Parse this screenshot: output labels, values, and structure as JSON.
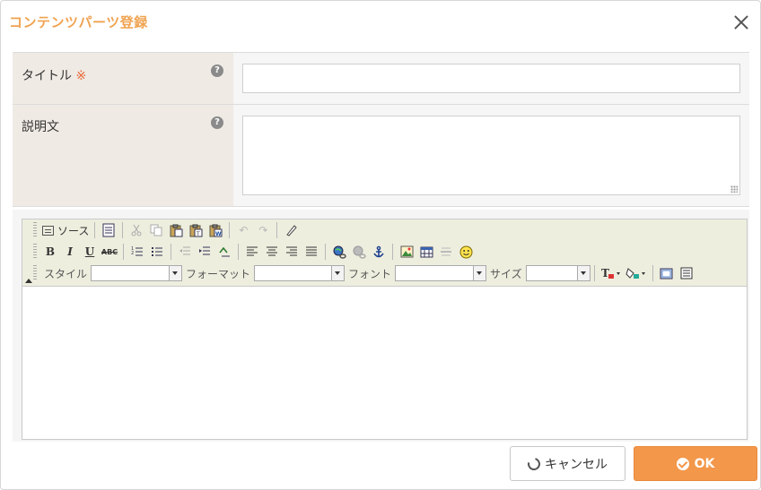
{
  "dialog": {
    "title": "コンテンツパーツ登録"
  },
  "form": {
    "title_field": {
      "label": "タイトル",
      "required_mark": "※",
      "value": ""
    },
    "description_field": {
      "label": "説明文",
      "value": ""
    },
    "help_glyph": "?"
  },
  "editor": {
    "toolbar": {
      "source_label": "ソース",
      "bold_glyph": "B",
      "italic_glyph": "I",
      "underline_glyph": "U",
      "strike_glyph": "ABC",
      "style_label": "スタイル",
      "format_label": "フォーマット",
      "font_label": "フォント",
      "size_label": "サイズ",
      "style_value": "",
      "format_value": "",
      "font_value": "",
      "size_value": ""
    },
    "content": ""
  },
  "footer": {
    "cancel_label": "キャンセル",
    "ok_label": "OK"
  },
  "colors": {
    "title": "#f0a350",
    "ok_button": "#f3974a",
    "label_bg": "#efeae4",
    "required": "#e86a3a"
  }
}
